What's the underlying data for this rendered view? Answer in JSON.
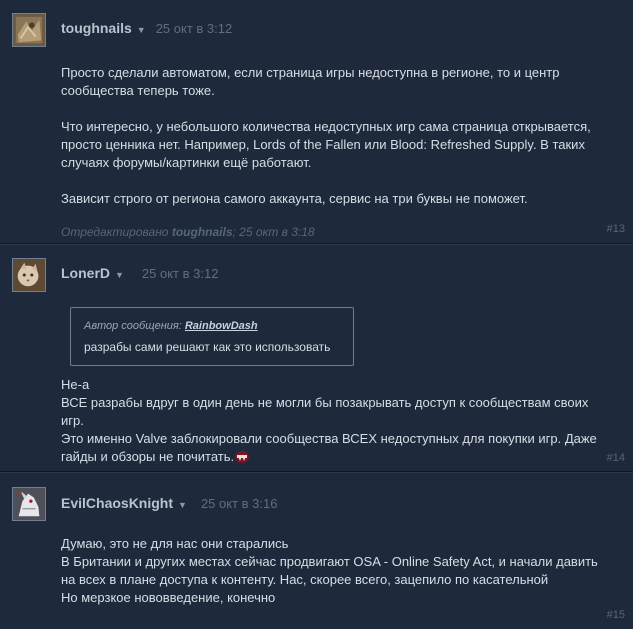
{
  "posts": [
    {
      "author": "toughnails",
      "timestamp": "25 окт в 3:12",
      "paragraphs": [
        "Просто сделали автоматом, если страница игры недоступна в регионе, то и центр сообщества теперь тоже.",
        "Что интересно, у небольшого количества недоступных игр сама страница открывается, просто ценника нет. Например, Lords of the Fallen или Blood: Refreshed Supply. В таких случаях форумы/картинки ещё работают.",
        "Зависит строго от региона самого аккаунта, сервис на три буквы не поможет."
      ],
      "edited_prefix": "Отредактировано",
      "edited_by": "toughnails",
      "edited_time": "; 25 окт в 3:18",
      "post_number": "#13"
    },
    {
      "author": "LonerD",
      "timestamp": "25 окт в 3:12",
      "quote": {
        "label": "Автор сообщения:",
        "author": "RainbowDash",
        "text": "разрабы сами решают как это использовать"
      },
      "lines": [
        "Не-а",
        "ВСЕ разрабы вдруг в один день не могли бы позакрывать доступ к сообществам своих игр.",
        "Это именно Valve заблокировали сообщества ВСЕХ недоступных для покупки игр. Даже гайды и обзоры не почитать."
      ],
      "post_number": "#14"
    },
    {
      "author": "EvilChaosKnight",
      "timestamp": "25 окт в 3:16",
      "lines": [
        "Думаю, это не для нас они старались",
        "В Британии и других местах сейчас продвигают OSA - Online Safety Act, и начали давить на всех в плане доступа к контенту. Нас, скорее всего, зацепило по касательной",
        "Но мерзкое нововведение, конечно"
      ],
      "post_number": "#15"
    }
  ]
}
